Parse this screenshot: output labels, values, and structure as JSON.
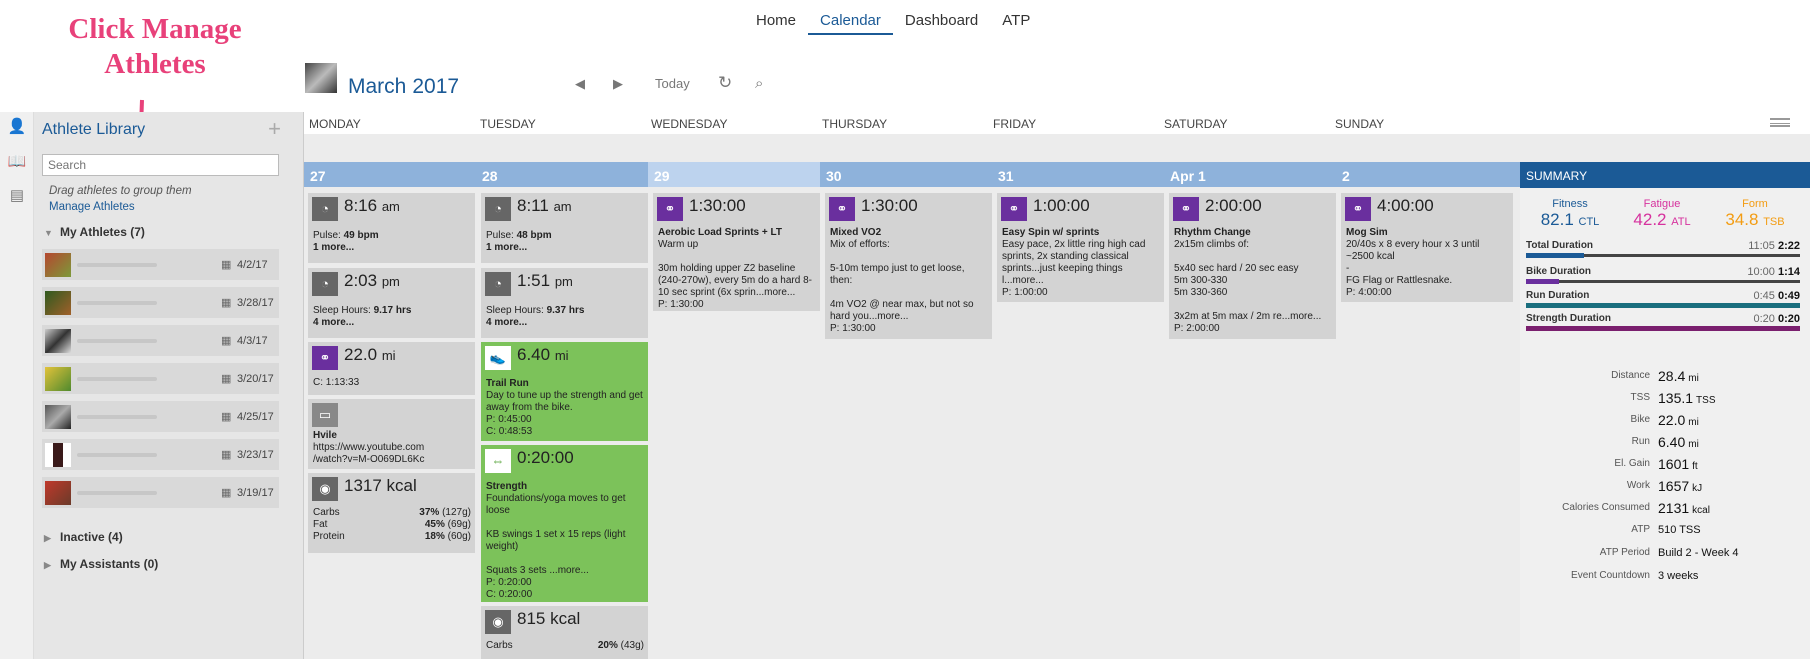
{
  "annotation": {
    "line1": "Click Manage",
    "line2": "Athletes",
    "color": "#e8417a"
  },
  "nav": {
    "items": [
      "Home",
      "Calendar",
      "Dashboard",
      "ATP"
    ],
    "active": "Calendar"
  },
  "header": {
    "month": "March",
    "year": "2017",
    "today_label": "Today"
  },
  "sidebar": {
    "title": "Athlete Library",
    "search_placeholder": "Search",
    "drag_hint": "Drag athletes to group them",
    "manage_link": "Manage Athletes",
    "my_athletes": "My Athletes (7)",
    "athletes": [
      {
        "date": "4/2/17"
      },
      {
        "date": "3/28/17"
      },
      {
        "date": "4/3/17"
      },
      {
        "date": "3/20/17"
      },
      {
        "date": "4/25/17"
      },
      {
        "date": "3/23/17"
      },
      {
        "date": "3/19/17"
      }
    ],
    "inactive": "Inactive (4)",
    "assistants": "My Assistants (0)"
  },
  "calendar": {
    "day_names": [
      "MONDAY",
      "TUESDAY",
      "WEDNESDAY",
      "THURSDAY",
      "FRIDAY",
      "SATURDAY",
      "SUNDAY"
    ],
    "dates": [
      "27",
      "28",
      "29",
      "30",
      "31",
      "Apr 1",
      "2"
    ],
    "mon": {
      "c1": {
        "time": "8:16",
        "ampm": "am",
        "l1k": "Pulse: ",
        "l1v": "49 bpm",
        "more": "1 more..."
      },
      "c2": {
        "time": "2:03",
        "ampm": "pm",
        "l1k": "Sleep Hours: ",
        "l1v": "9.17 hrs",
        "more": "4 more..."
      },
      "c3": {
        "dist": "22.0",
        "unit": "mi",
        "c": "C: 1:13:33"
      },
      "c4": {
        "title": "Hvile",
        "url1": "https://www.youtube.com",
        "url2": "/watch?v=M-O069DL6Kc"
      },
      "c5": {
        "kcal": "1317 kcal",
        "carbs": "Carbs",
        "carbs_v": "37%",
        "carbs_g": "(127g)",
        "fat": "Fat",
        "fat_v": "45%",
        "fat_g": "(69g)",
        "protein": "Protein",
        "protein_v": "18%",
        "protein_g": "(60g)"
      }
    },
    "tue": {
      "c1": {
        "time": "8:11",
        "ampm": "am",
        "l1k": "Pulse: ",
        "l1v": "48 bpm",
        "more": "1 more..."
      },
      "c2": {
        "time": "1:51",
        "ampm": "pm",
        "l1k": "Sleep Hours: ",
        "l1v": "9.37 hrs",
        "more": "4 more..."
      },
      "c3": {
        "dist": "6.40",
        "unit": "mi",
        "title": "Trail Run",
        "desc": "Day to tune up the strength and get away from the bike.",
        "p": "P: 0:45:00",
        "c": "C: 0:48:53"
      },
      "c4": {
        "dur": "0:20:00",
        "title": "Strength",
        "desc": "Foundations/yoga moves to get loose",
        "desc2": "KB swings 1 set x 15 reps (light weight)",
        "desc3": "Squats 3 sets ...more...",
        "p": "P: 0:20:00",
        "c": "C: 0:20:00"
      },
      "c5": {
        "kcal": "815 kcal",
        "carbs": "Carbs",
        "carbs_v": "20%",
        "carbs_g": "(43g)"
      }
    },
    "wed": {
      "dur": "1:30:00",
      "title": "Aerobic Load Sprints + LT",
      "l1": "Warm up",
      "l2": "30m holding upper Z2 baseline (240-270w), every 5m do a hard 8-10 sec sprint (6x sprin...more...",
      "p": "P: 1:30:00"
    },
    "thu": {
      "dur": "1:30:00",
      "title": "Mixed VO2",
      "l1": "Mix of efforts:",
      "l2": "5-10m tempo just to get loose, then:",
      "l3": "4m VO2 @ near max, but not so hard you...more...",
      "p": "P: 1:30:00"
    },
    "fri": {
      "dur": "1:00:00",
      "title": "Easy Spin w/ sprints",
      "l1": "Easy pace, 2x little ring high cad sprints, 2x standing classical sprints...just keeping things l...more...",
      "p": "P: 1:00:00"
    },
    "sat": {
      "dur": "2:00:00",
      "title": "Rhythm Change",
      "l1": "2x15m climbs of:",
      "l2": "5x40 sec hard / 20 sec easy",
      "l3": "5m 300-330",
      "l4": "5m 330-360",
      "l5": "3x2m at 5m max / 2m re...more...",
      "p": "P: 2:00:00"
    },
    "sun": {
      "dur": "4:00:00",
      "title": "Mog Sim",
      "l1": "20/40s x 8 every hour x 3 until ~2500 kcal",
      "l2": "-",
      "l3": "FG Flag or Rattlesnake.",
      "p": "P: 4:00:00"
    }
  },
  "summary": {
    "header": "SUMMARY",
    "fitness": {
      "label": "Fitness",
      "value": "82.1",
      "unit": "CTL",
      "color": "#1b5a96"
    },
    "fatigue": {
      "label": "Fatigue",
      "value": "42.2",
      "unit": "ATL",
      "color": "#d6329e"
    },
    "form": {
      "label": "Form",
      "value": "34.8",
      "unit": "TSB",
      "color": "#f39c12"
    },
    "durations": [
      {
        "label": "Total Duration",
        "planned": "11:05",
        "done": "2:22",
        "fraction": 0.21,
        "color": "#1b5a96"
      },
      {
        "label": "Bike Duration",
        "planned": "10:00",
        "done": "1:14",
        "fraction": 0.12,
        "color": "#6a2f9e"
      },
      {
        "label": "Run Duration",
        "planned": "0:45",
        "done": "0:49",
        "fraction": 1.0,
        "color": "#1a6e7e"
      },
      {
        "label": "Strength Duration",
        "planned": "0:20",
        "done": "0:20",
        "fraction": 1.0,
        "color": "#7a1f6e"
      }
    ],
    "stats": [
      {
        "k": "Distance",
        "v": "28.4",
        "u": "mi"
      },
      {
        "k": "TSS",
        "v": "135.1",
        "u": "TSS"
      },
      {
        "k": "Bike",
        "v": "22.0",
        "u": "mi"
      },
      {
        "k": "Run",
        "v": "6.40",
        "u": "mi"
      },
      {
        "k": "El. Gain",
        "v": "1601",
        "u": "ft"
      },
      {
        "k": "Work",
        "v": "1657",
        "u": "kJ"
      },
      {
        "k": "Calories Consumed",
        "v": "2131",
        "u": "kcal"
      },
      {
        "k": "ATP",
        "v": "510 TSS",
        "u": ""
      },
      {
        "k": "ATP Period",
        "v": "Build 2 - Week 4",
        "u": ""
      },
      {
        "k": "Event Countdown",
        "v": "3 weeks",
        "u": ""
      }
    ]
  }
}
